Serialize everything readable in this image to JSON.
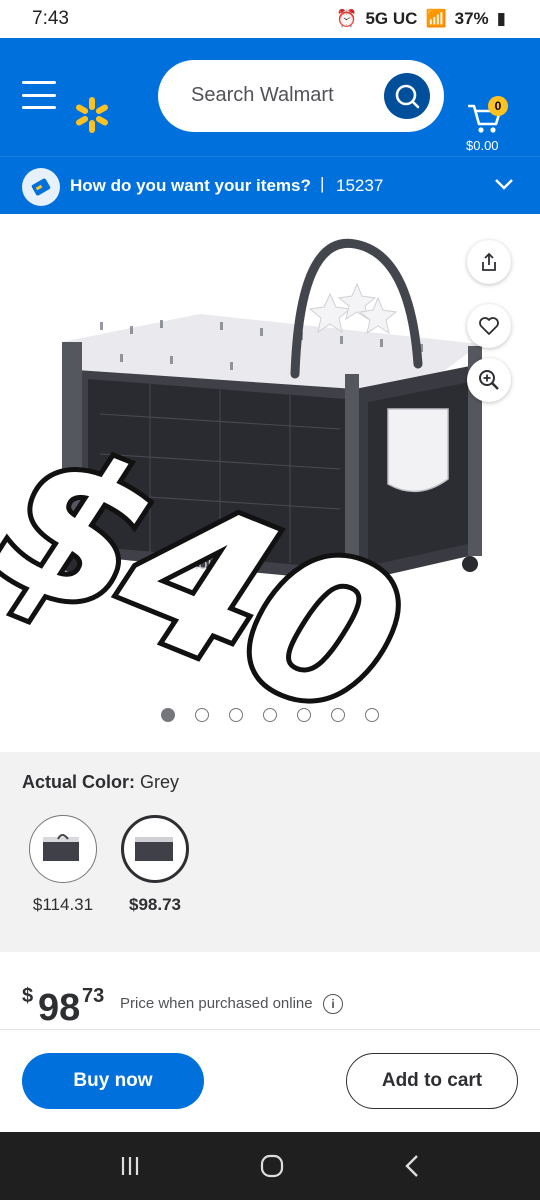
{
  "status": {
    "time": "7:43",
    "network": "5G UC",
    "battery": "37%"
  },
  "header": {
    "search_placeholder": "Search Walmart",
    "cart_count": "0",
    "cart_total": "$0.00"
  },
  "delivery": {
    "prompt": "How do you want your items?",
    "separator": "|",
    "zip": "15237"
  },
  "hero": {
    "overlay_text": "$40",
    "image_count": 7,
    "active_image": 1
  },
  "variant": {
    "label": "Actual Color:",
    "value": "Grey",
    "options": [
      {
        "price": "$114.31",
        "selected": false
      },
      {
        "price": "$98.73",
        "selected": true
      }
    ]
  },
  "price": {
    "currency": "$",
    "dollars": "98",
    "cents": "73",
    "note": "Price when purchased online",
    "info": "i"
  },
  "actions": {
    "buy_now": "Buy now",
    "add_to_cart": "Add to cart"
  },
  "colors": {
    "brand_blue": "#0071dc",
    "dark_blue": "#004f9a",
    "spark_yellow": "#ffc220"
  },
  "icons": {
    "menu": "menu-icon",
    "logo": "spark-logo-icon",
    "search": "search-icon",
    "cart": "cart-icon",
    "share": "share-icon",
    "favorite": "heart-icon",
    "zoom": "zoom-icon",
    "chevron": "chevron-down-icon",
    "info": "info-icon"
  }
}
